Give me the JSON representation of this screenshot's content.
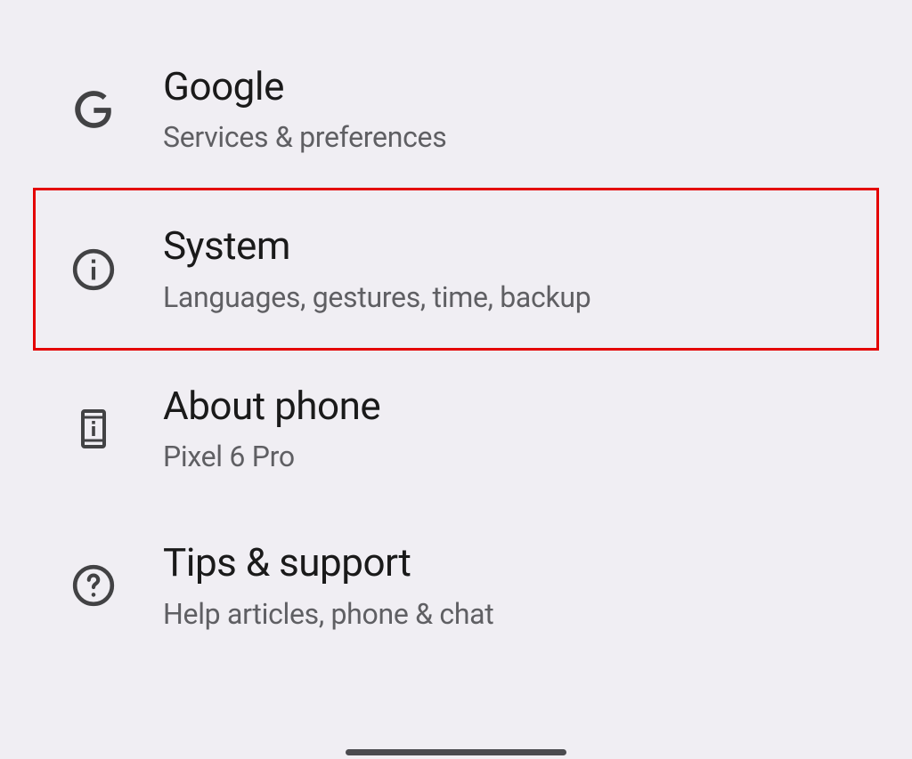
{
  "settings": {
    "items": [
      {
        "title": "Google",
        "subtitle": "Services & preferences",
        "highlighted": false
      },
      {
        "title": "System",
        "subtitle": "Languages, gestures, time, backup",
        "highlighted": true
      },
      {
        "title": "About phone",
        "subtitle": "Pixel 6 Pro",
        "highlighted": false
      },
      {
        "title": "Tips & support",
        "subtitle": "Help articles, phone & chat",
        "highlighted": false
      }
    ]
  }
}
